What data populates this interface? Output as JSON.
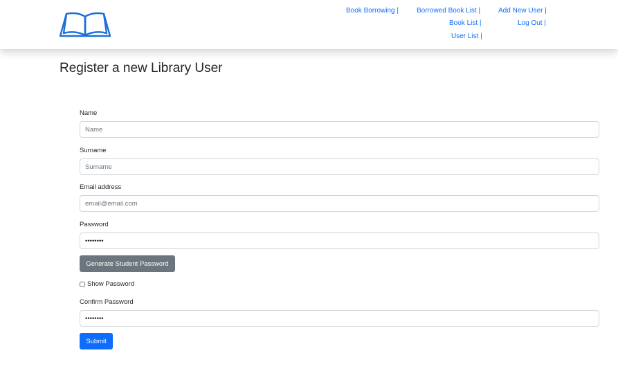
{
  "header": {
    "logo_icon": "open-book-icon",
    "accent_color": "#0d6efd",
    "nav": {
      "book_borrowing": "Book Borrowing |",
      "borrowed_book_list": "Borrowed Book List |",
      "add_new_user": "Add New User |",
      "book_list": "Book List |",
      "log_out": "Log Out |",
      "user_list": "User List |"
    }
  },
  "page": {
    "title": "Register a new Library User"
  },
  "form": {
    "name_label": "Name",
    "name_placeholder": "Name",
    "surname_label": "Surname",
    "surname_placeholder": "Surname",
    "email_label": "Email address",
    "email_placeholder": "email@email.com",
    "password_label": "Password",
    "password_value": "••••••••",
    "generate_button": "Generate Student Password",
    "show_password_label": "Show Password",
    "show_password_checked": false,
    "confirm_password_label": "Confirm Password",
    "confirm_password_value": "••••••••",
    "submit_button": "Submit"
  }
}
